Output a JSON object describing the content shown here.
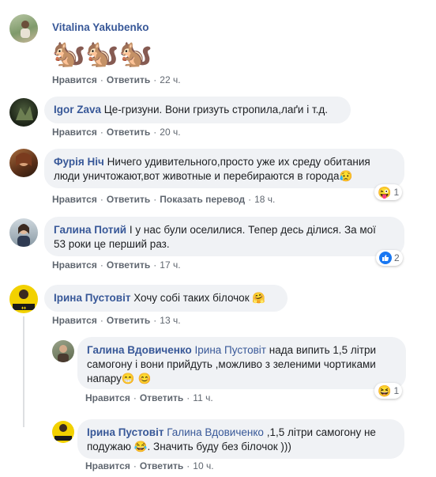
{
  "actions": {
    "like": "Нравится",
    "reply": "Ответить",
    "translate": "Показать перевод"
  },
  "comments": [
    {
      "author": "Vitalina Yakubenko",
      "text": "🐿️🐿️🐿️",
      "time": "22 ч."
    },
    {
      "author": "Igor Zava",
      "text": "Це-гризуни. Вони гризуть стропила,лаґи і т.д.",
      "time": "20 ч."
    },
    {
      "author": "Фурія Ніч",
      "text_line1": "Ничего удивительного,просто уже их среду обитания",
      "text_line2": "люди уничтожают,вот животные и перебираются в города",
      "time": "18 ч.",
      "reaction_count": "1"
    },
    {
      "author": "Галина Потий",
      "text_line1": "І у нас були оселилися. Тепер десь ділися. За мої",
      "text_line2": "53 роки це перший раз.",
      "time": "17 ч.",
      "reaction_count": "2"
    },
    {
      "author": "Ірина Пустовіт",
      "text": "Хочу собі таких білочок",
      "time": "13 ч."
    }
  ],
  "replies": [
    {
      "author": "Галина Вдовиченко",
      "mention": "Ірина Пустовіт",
      "text_line1": "нада випить 1,5 літри",
      "text_line2": "самогону і вони прийдуть ,можливо з зеленими чортиками",
      "text_line3": "напару",
      "time": "11 ч.",
      "reaction_count": "1"
    },
    {
      "author": "Ірина Пустовіт",
      "mention": "Галина Вдовиченко",
      "text_line1": ",1,5 літри самогону не",
      "text_line2": "подужаю",
      "text_line2b": ". Значить буду без білочок )))",
      "time": "10 ч."
    }
  ]
}
